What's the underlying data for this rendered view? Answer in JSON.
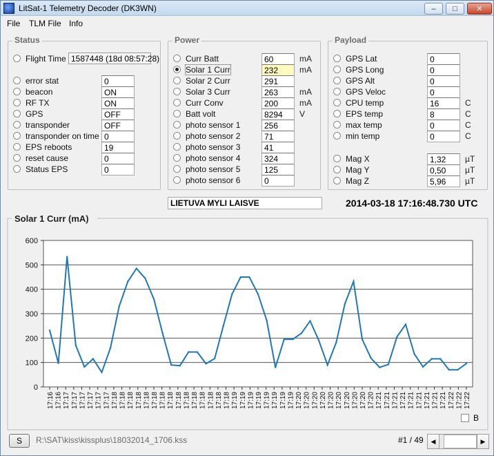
{
  "window": {
    "title": "LitSat-1 Telemetry Decoder (DK3WN)",
    "minimize_glyph": "–",
    "maximize_glyph": "□",
    "close_glyph": "✕"
  },
  "menu": [
    "File",
    "TLM File",
    "Info"
  ],
  "status": {
    "legend": "Status",
    "flight_time_label": "Flight Time",
    "flight_time_value": "1587448 (18d 08:57:28)",
    "rows": [
      {
        "label": "error stat",
        "value": "0"
      },
      {
        "label": "beacon",
        "value": "ON"
      },
      {
        "label": "RF TX",
        "value": "ON"
      },
      {
        "label": "GPS",
        "value": "OFF"
      },
      {
        "label": "transponder",
        "value": "OFF"
      },
      {
        "label": "transponder on time",
        "value": "0"
      },
      {
        "label": "EPS reboots",
        "value": "19"
      },
      {
        "label": "reset cause",
        "value": "0"
      },
      {
        "label": "Status EPS",
        "value": "0"
      }
    ]
  },
  "power": {
    "legend": "Power",
    "rows": [
      {
        "label": "Curr Batt",
        "value": "60",
        "unit": "mA"
      },
      {
        "label": "Solar 1 Curr",
        "value": "232",
        "unit": "mA"
      },
      {
        "label": "Solar 2 Curr",
        "value": "291",
        "unit": ""
      },
      {
        "label": "Solar 3 Curr",
        "value": "263",
        "unit": "mA"
      },
      {
        "label": "Curr Conv",
        "value": "200",
        "unit": "mA"
      },
      {
        "label": "Batt volt",
        "value": "8294",
        "unit": "V"
      },
      {
        "label": "photo sensor 1",
        "value": "256",
        "unit": ""
      },
      {
        "label": "photo sensor 2",
        "value": "71",
        "unit": ""
      },
      {
        "label": "photo sensor 3",
        "value": "41",
        "unit": ""
      },
      {
        "label": "photo sensor 4",
        "value": "324",
        "unit": ""
      },
      {
        "label": "photo sensor 5",
        "value": "125",
        "unit": ""
      },
      {
        "label": "photo sensor 6",
        "value": "0",
        "unit": ""
      }
    ]
  },
  "payload": {
    "legend": "Payload",
    "rows": [
      {
        "label": "GPS Lat",
        "value": "0",
        "unit": ""
      },
      {
        "label": "GPS Long",
        "value": "0",
        "unit": ""
      },
      {
        "label": "GPS Alt",
        "value": "0",
        "unit": ""
      },
      {
        "label": "GPS Veloc",
        "value": "0",
        "unit": ""
      },
      {
        "label": "CPU temp",
        "value": "16",
        "unit": "C"
      },
      {
        "label": "EPS temp",
        "value": "8",
        "unit": "C"
      },
      {
        "label": "max temp",
        "value": "0",
        "unit": "C"
      },
      {
        "label": "min temp",
        "value": "0",
        "unit": "C"
      }
    ],
    "mag_rows": [
      {
        "label": "Mag X",
        "value": "1,32",
        "unit": "µT"
      },
      {
        "label": "Mag Y",
        "value": "0,50",
        "unit": "µT"
      },
      {
        "label": "Mag Z",
        "value": "5,96",
        "unit": "µT"
      }
    ]
  },
  "motto": "LIETUVA MYLI LAISVE",
  "timestamp": "2014-03-18 17:16:48.730 UTC",
  "chart_data": {
    "type": "line",
    "title": "Solar 1 Curr (mA)",
    "ylim": [
      0,
      600
    ],
    "yticks": [
      0,
      100,
      200,
      300,
      400,
      500,
      600
    ],
    "grid": true,
    "series_color": "#1f77b4",
    "categories": [
      "17:16",
      "17:16",
      "17:17",
      "17:17",
      "17:17",
      "17:17",
      "17:17",
      "17:17",
      "17:18",
      "17:18",
      "17:18",
      "17:18",
      "17:18",
      "17:18",
      "17:18",
      "17:18",
      "17:18",
      "17:18",
      "17:18",
      "17:18",
      "17:18",
      "17:18",
      "17:18",
      "17:19",
      "17:19",
      "17:19",
      "17:19",
      "17:19",
      "17:19",
      "17:19",
      "17:19",
      "17:20",
      "17:20",
      "17:20",
      "17:20",
      "17:20",
      "17:20",
      "17:20",
      "17:20",
      "17:20",
      "17:20",
      "17:21",
      "17:21",
      "17:21",
      "17:21",
      "17:21",
      "17:21",
      "17:21",
      "17:21",
      "17:21",
      "17:22",
      "17:22",
      "17:22"
    ],
    "values": [
      232,
      97,
      533,
      170,
      82,
      115,
      60,
      160,
      330,
      432,
      485,
      445,
      360,
      220,
      90,
      87,
      143,
      143,
      95,
      116,
      250,
      380,
      450,
      450,
      380,
      272,
      80,
      195,
      195,
      220,
      270,
      190,
      90,
      182,
      340,
      432,
      195,
      118,
      80,
      92,
      205,
      256,
      135,
      82,
      115,
      115,
      70,
      70,
      96
    ]
  },
  "b_label": "B",
  "footer": {
    "s_button": "S",
    "file_path": "R:\\SAT\\kiss\\kissplus\\18032014_1706.kss",
    "page_indicator": "#1 / 49",
    "left_arrow": "◀",
    "right_arrow": "▶"
  }
}
